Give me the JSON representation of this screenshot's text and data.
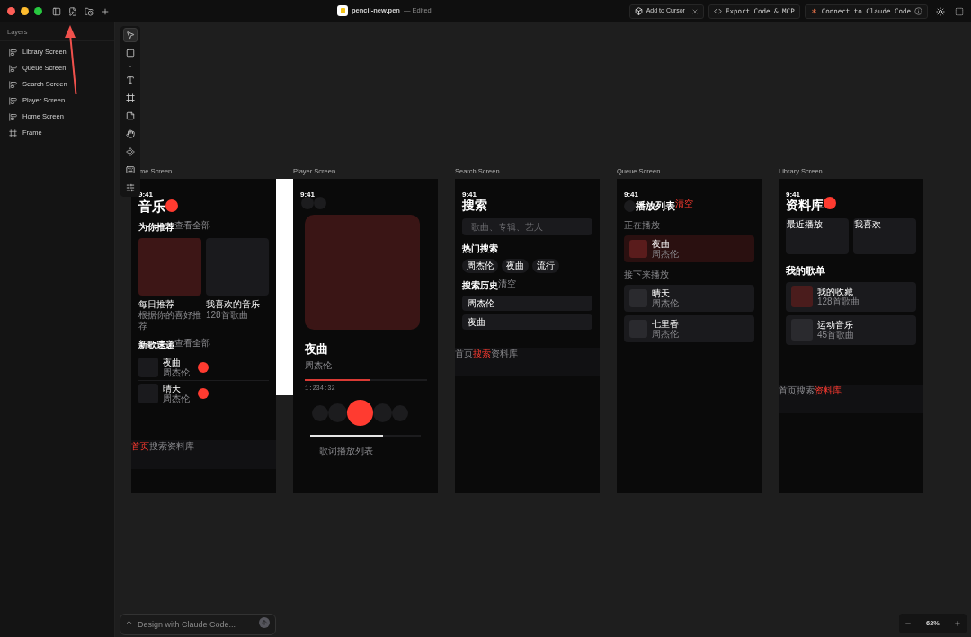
{
  "window": {
    "file": "pencil-new.pen",
    "status": "— Edited"
  },
  "actions": {
    "cursor": "Add to Cursor",
    "export": "Export Code & MCP",
    "connect": "Connect to Claude Code"
  },
  "layers": {
    "title": "Layers",
    "items": [
      {
        "label": "Library Screen",
        "kind": "screen"
      },
      {
        "label": "Queue Screen",
        "kind": "screen"
      },
      {
        "label": "Search Screen",
        "kind": "screen"
      },
      {
        "label": "Player Screen",
        "kind": "screen"
      },
      {
        "label": "Home Screen",
        "kind": "screen"
      },
      {
        "label": "Frame",
        "kind": "frame"
      }
    ]
  },
  "tools": [
    {
      "kind": "select",
      "selected": true
    },
    {
      "kind": "rectangle",
      "selected": false
    },
    {
      "kind": "more",
      "selected": false
    },
    {
      "kind": "text",
      "selected": false
    },
    {
      "kind": "frame",
      "selected": false
    },
    {
      "kind": "note",
      "selected": false
    },
    {
      "kind": "hand",
      "selected": false
    },
    {
      "kind": "component",
      "selected": false
    },
    {
      "kind": "keyboard",
      "selected": false
    },
    {
      "kind": "adjust",
      "selected": false
    }
  ],
  "screens": [
    {
      "kind": "home",
      "label": "me Screen",
      "time": "9:41",
      "title": "音乐",
      "featured": {
        "heading": "为你推荐",
        "more": "查看全部",
        "cards": [
          {
            "title": "每日推荐",
            "subtitle": "根据你的喜好推荐",
            "color": "#3d1616"
          },
          {
            "title": "我喜欢的音乐",
            "subtitle": "128首歌曲",
            "color": "#1a1a1d"
          }
        ]
      },
      "new": {
        "heading": "新歌速递",
        "more": "查看全部",
        "songs": [
          {
            "title": "夜曲",
            "artist": "周杰伦"
          },
          {
            "title": "晴天",
            "artist": "周杰伦"
          }
        ]
      },
      "nav": [
        {
          "label": "首页",
          "selected": true
        },
        {
          "label": "搜索",
          "selected": false
        },
        {
          "label": "资料库",
          "selected": false
        }
      ]
    },
    {
      "kind": "player",
      "label": "Player Screen",
      "time": "9:41",
      "song": "夜曲",
      "artist": "周杰伦",
      "progress": {
        "level": 0.53
      },
      "elapsed": "1:234:32",
      "volume": {
        "level": 0.66
      },
      "tabs": [
        "歌词",
        "播放列表"
      ]
    },
    {
      "kind": "search",
      "label": "Search Screen",
      "time": "9:41",
      "title": "搜索",
      "placeholder": "歌曲、专辑、艺人",
      "hot_heading": "热门搜索",
      "hot": [
        "周杰伦",
        "夜曲",
        "流行"
      ],
      "history_heading": "搜索历史",
      "clear": "清空",
      "history": [
        "周杰伦",
        "夜曲"
      ],
      "nav": [
        {
          "label": "首页",
          "selected": false
        },
        {
          "label": "搜索",
          "selected": true
        },
        {
          "label": "资料库",
          "selected": false
        }
      ]
    },
    {
      "kind": "queue",
      "label": "Queue Screen",
      "time": "9:41",
      "title": "播放列表",
      "clear": "清空",
      "now_heading": "正在播放",
      "now": {
        "title": "夜曲",
        "artist": "周杰伦"
      },
      "next_heading": "接下来播放",
      "next": [
        {
          "title": "晴天",
          "artist": "周杰伦"
        },
        {
          "title": "七里香",
          "artist": "周杰伦"
        }
      ]
    },
    {
      "kind": "library",
      "label": "Library Screen",
      "time": "9:41",
      "title": "资料库",
      "tiles": [
        "最近播放",
        "我喜欢"
      ],
      "playlists_heading": "我的歌单",
      "playlists": [
        {
          "title": "我的收藏",
          "count": "128首歌曲",
          "color": "#4a1c1c"
        },
        {
          "title": "运动音乐",
          "count": "45首歌曲",
          "color": "#2a2a2e"
        }
      ],
      "nav": [
        {
          "label": "首页",
          "selected": false
        },
        {
          "label": "搜索",
          "selected": false
        },
        {
          "label": "资料库",
          "selected": true
        }
      ]
    }
  ],
  "prompt": {
    "placeholder": "Design with Claude Code..."
  },
  "zoom": {
    "value": "62%"
  }
}
